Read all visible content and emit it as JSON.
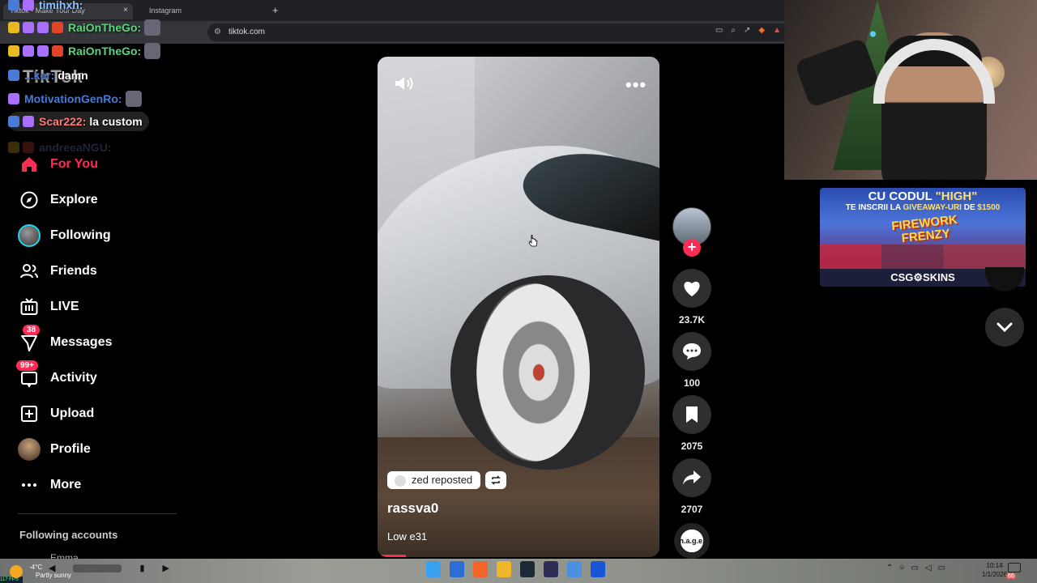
{
  "browser": {
    "tab_active": "Tiktok - Make Your Day",
    "tab_2": "Instagram",
    "tab_close": "×",
    "new_tab": "+",
    "url": "tiktok.com"
  },
  "chat": {
    "lines": [
      {
        "user": "timihxh:",
        "msg": "",
        "color": "#6db2ff"
      },
      {
        "user": "RaiOnTheGo:",
        "msg": "",
        "color": "#5ad67d"
      },
      {
        "user": "RaiOnTheGo:",
        "msg": "",
        "color": "#5ad67d"
      },
      {
        "user": "...ker:",
        "msg": "damn",
        "color": "#4a7bd6"
      },
      {
        "user": "MotivationGenRo:",
        "msg": "",
        "color": "#4a7bd6"
      },
      {
        "user": "Scar222:",
        "msg": "la custom",
        "color": "#ff6b6b"
      },
      {
        "user": "andreeaNGU:",
        "msg": "",
        "color": "#7a8fd0"
      }
    ]
  },
  "logo": "TikTok",
  "nav": {
    "items": [
      {
        "label": "For You",
        "icon": "home-icon"
      },
      {
        "label": "Explore",
        "icon": "compass-icon"
      },
      {
        "label": "Following",
        "icon": "following-avatar"
      },
      {
        "label": "Friends",
        "icon": "friends-icon"
      },
      {
        "label": "LIVE",
        "icon": "live-icon"
      },
      {
        "label": "Messages",
        "icon": "messages-icon",
        "badge": "38"
      },
      {
        "label": "Activity",
        "icon": "activity-icon",
        "badge": "99+"
      },
      {
        "label": "Upload",
        "icon": "upload-icon"
      },
      {
        "label": "Profile",
        "icon": "profile-avatar"
      },
      {
        "label": "More",
        "icon": "more-icon"
      }
    ],
    "following_accounts": "Following accounts",
    "first_account": "Emma"
  },
  "video": {
    "repost_text": "zed reposted",
    "author": "rassva0",
    "caption": "Low e31",
    "progress_fraction": 0.1
  },
  "actions": {
    "likes": "23.7K",
    "comments": "100",
    "bookmarks": "2075",
    "shares": "2707",
    "music_label": "h.a.g.e."
  },
  "ad": {
    "line1_prefix": "CU CODUL",
    "line1_highlight": "\"HIGH\"",
    "line2_prefix": "TE INSCRII LA",
    "line2_highlight": "GIVEAWAY-URI",
    "line2_mid": "DE",
    "line2_amount": "$1500",
    "event": "FIREWORK FRENZY",
    "brand": "CSG⚙SKINS"
  },
  "taskbar": {
    "fps": "117 FPS",
    "temp": "-4°C",
    "weather": "Partly sunny",
    "time": "10:14",
    "date": "1/1/2026",
    "notifications": "66"
  },
  "colors": {
    "accent": "#fe2c55",
    "following_ring": "#20d5ec"
  }
}
